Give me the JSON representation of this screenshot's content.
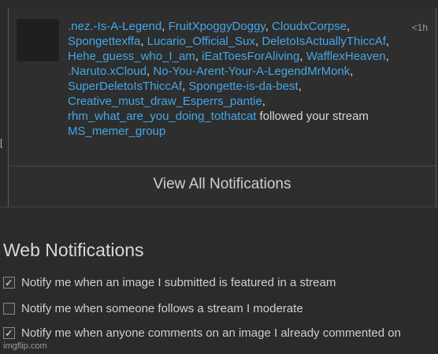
{
  "notification": {
    "time": "<1h",
    "users": [
      ".nez.-Is-A-Legend",
      "FruitXpoggyDoggy",
      "CloudxCorpse",
      "Spongettexffa",
      "Lucario_Official_Sux",
      "DeletoIsActuallyThiccAf",
      "Hehe_guess_who_I_am",
      "iEatToesForAliving",
      "WafflexHeaven",
      ".Naruto.xCloud",
      "No-You-Arent-Your-A-LegendMrMonk",
      "SuperDeletoIsThiccAf",
      "Spongette-is-da-best",
      "Creative_must_draw_Esperrs_pantie",
      "rhm_what_are_you_doing_tothatcat"
    ],
    "action_text": " followed your stream ",
    "stream_name": "MS_memer_group"
  },
  "view_all_label": "View All Notifications",
  "web_notifications": {
    "title": "Web Notifications",
    "options": [
      {
        "label": "Notify me when an image I submitted is featured in a stream",
        "checked": true
      },
      {
        "label": "Notify me when someone follows a stream I moderate",
        "checked": false
      },
      {
        "label": "Notify me when anyone comments on an image I already commented on",
        "checked": true
      }
    ]
  },
  "watermark": "imgflip.com",
  "left_glyph": "["
}
